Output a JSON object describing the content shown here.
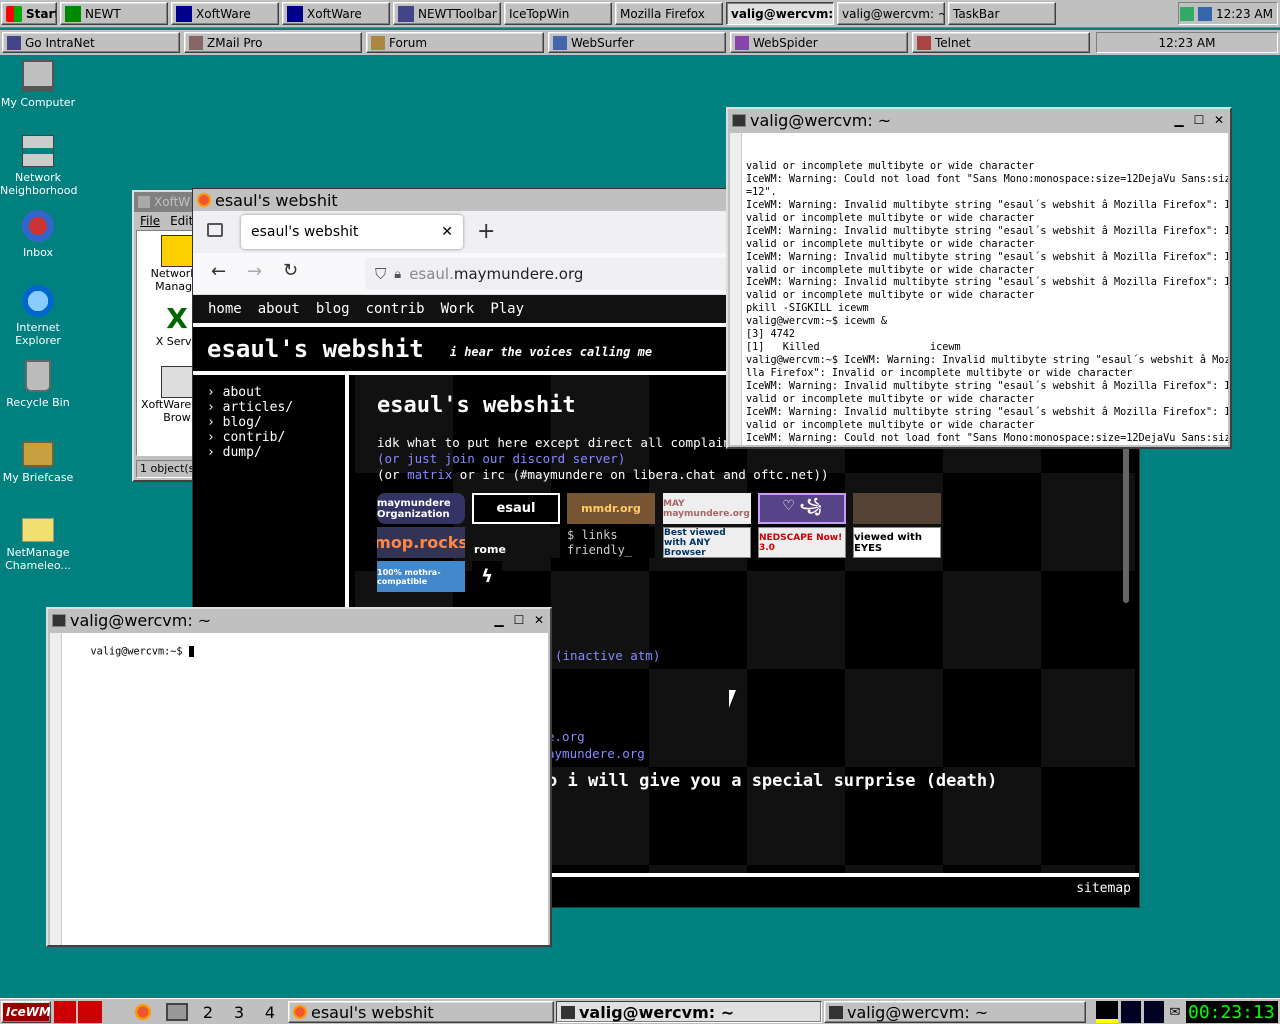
{
  "topbar": {
    "start": "Start",
    "tasks": [
      "NEWT",
      "XoftWare",
      "XoftWare",
      "NEWTToolbar",
      "IceTopWin",
      "Mozilla Firefox",
      "valig@wercvm: ~",
      "valig@wercvm: ~",
      "TaskBar"
    ],
    "clock": "12:23 AM"
  },
  "quicklaunch": {
    "items": [
      "Go IntraNet",
      "ZMail Pro",
      "Forum",
      "WebSurfer",
      "WebSpider",
      "Telnet"
    ],
    "clock": "12:23 AM"
  },
  "desktop": {
    "icons": [
      "My Computer",
      "Network Neighborhood",
      "Inbox",
      "Internet Explorer",
      "Recycle Bin",
      "My Briefcase",
      "NetManage Chameleo..."
    ]
  },
  "xoftware": {
    "title": "XoftW",
    "menu": [
      "File",
      "Edit"
    ],
    "items": [
      "Network I Manage",
      "X Serve",
      "XoftWare File Brow"
    ],
    "status": "1 object(s)"
  },
  "firefox": {
    "title": "esaul's webshit",
    "tab_title": "esaul's webshit",
    "url_host": "esaul.",
    "url_domain": "maymundere.org",
    "site": {
      "nav": [
        "home",
        "about",
        "blog",
        "contrib",
        "Work",
        "Play"
      ],
      "header_title": "esaul's webshit",
      "header_tagline": "i hear the voices calling me",
      "sidebar": [
        "about",
        "articles/",
        "blog/",
        "contrib/",
        "dump/"
      ],
      "main_title": "esaul's webshit",
      "intro": "idk what to put here except direct all complaints",
      "discord": "(or just join our discord server)",
      "matrix_prefix": "(or ",
      "matrix_link": "matrix",
      "matrix_suffix": " or irc (#maymundere on libera.chat and oftc.net))",
      "badges": [
        "maymundere Organization",
        "esaul",
        "mmdr.org",
        "MAY maymundere.org",
        "♡ ꧁",
        "",
        "mop.rocks",
        "rome",
        "$ links friendly_",
        "Best viewed with ANY Browser",
        "NEDSCAPE Now! 3.0",
        "viewed with EYES",
        "100% mothra-compatible",
        "ϟ"
      ],
      "inactive": "(inactive atm)",
      "link1": "e.org",
      "link2": "aymundere.org",
      "warning": "o i will give you a special surprise (death)",
      "sitemap": "sitemap"
    }
  },
  "term_top": {
    "title": "valig@wercvm: ~",
    "lines": [
      "valid or incomplete multibyte or wide character",
      "IceWM: Warning: Could not load font \"Sans Mono:monospace:size=12DejaVu Sans:size",
      "=12\".",
      "IceWM: Warning: Invalid multibyte string \"esaul´s webshit â Mozilla Firefox\": In",
      "valid or incomplete multibyte or wide character",
      "IceWM: Warning: Invalid multibyte string \"esaul´s webshit â Mozilla Firefox\": In",
      "valid or incomplete multibyte or wide character",
      "IceWM: Warning: Invalid multibyte string \"esaul´s webshit â Mozilla Firefox\": In",
      "valid or incomplete multibyte or wide character",
      "IceWM: Warning: Invalid multibyte string \"esaul´s webshit â Mozilla Firefox\": In",
      "valid or incomplete multibyte or wide character",
      "pkill -SIGKILL icewm",
      "valig@wercvm:~$ icewm &",
      "[3] 4742",
      "[1]   Killed                  icewm",
      "valig@wercvm:~$ IceWM: Warning: Invalid multibyte string \"esaul´s webshit â Mozi",
      "lla Firefox\": Invalid or incomplete multibyte or wide character",
      "IceWM: Warning: Invalid multibyte string \"esaul´s webshit â Mozilla Firefox\": In",
      "valid or incomplete multibyte or wide character",
      "IceWM: Warning: Invalid multibyte string \"esaul´s webshit â Mozilla Firefox\": In",
      "valid or incomplete multibyte or wide character",
      "IceWM: Warning: Could not load font \"Sans Mono:monospace:size=12DejaVu Sans:size",
      "=12\"."
    ]
  },
  "term_bottom": {
    "title": "valig@wercvm: ~",
    "prompt": "valig@wercvm:~$ "
  },
  "bottombar": {
    "workspaces": [
      "2",
      "3",
      "4"
    ],
    "tasks": [
      "esaul's webshit",
      "valig@wercvm: ~",
      "valig@wercvm: ~"
    ],
    "clock": "00:23:13"
  }
}
